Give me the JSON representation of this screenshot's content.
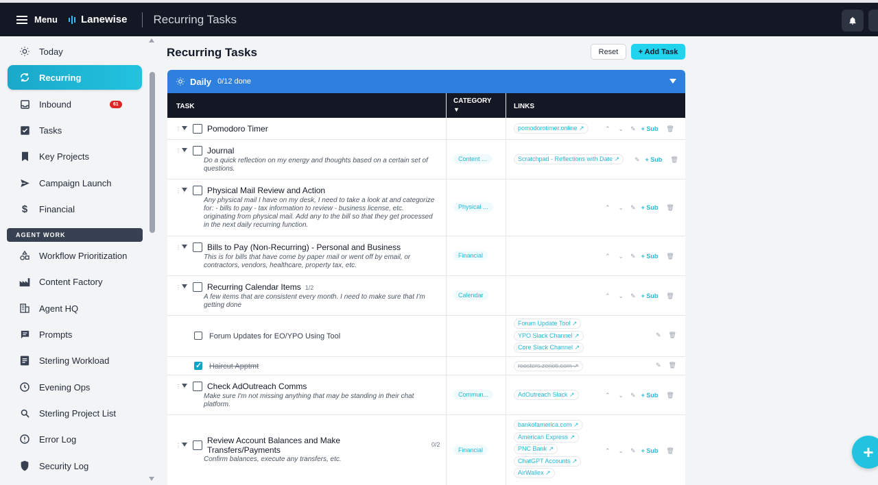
{
  "topbar": {
    "menu_label": "Menu",
    "brand": "Lanewise",
    "page_title": "Recurring Tasks",
    "bell_icon": "bell-icon"
  },
  "sidebar": {
    "items": [
      {
        "label": "Today",
        "icon": "sun-icon"
      },
      {
        "label": "Recurring",
        "icon": "refresh-icon",
        "active": true
      },
      {
        "label": "Inbound",
        "icon": "inbox-icon",
        "badge": "61"
      },
      {
        "label": "Tasks",
        "icon": "checkbox-icon"
      },
      {
        "label": "Key Projects",
        "icon": "bookmark-icon"
      },
      {
        "label": "Campaign Launch",
        "icon": "send-icon"
      },
      {
        "label": "Financial",
        "icon": "dollar-icon"
      }
    ],
    "section_label": "AGENT WORK",
    "agent_items": [
      {
        "label": "Workflow Prioritization",
        "icon": "shapes-icon"
      },
      {
        "label": "Content Factory",
        "icon": "factory-icon"
      },
      {
        "label": "Agent HQ",
        "icon": "building-icon"
      },
      {
        "label": "Prompts",
        "icon": "chat-icon"
      },
      {
        "label": "Sterling Workload",
        "icon": "document-icon"
      },
      {
        "label": "Evening Ops",
        "icon": "clock-icon"
      },
      {
        "label": "Sterling Project List",
        "icon": "search-icon"
      },
      {
        "label": "Error Log",
        "icon": "alert-icon"
      },
      {
        "label": "Security Log",
        "icon": "shield-icon"
      }
    ]
  },
  "main": {
    "title": "Recurring Tasks",
    "reset_label": "Reset",
    "add_label": "+ Add Task",
    "group": {
      "name": "Daily",
      "progress": "0/12 done"
    },
    "columns": {
      "task": "TASK",
      "category": "CATEGORY",
      "category_sort": "▼",
      "links": "LINKS"
    },
    "tasks": [
      {
        "title": "Pomodoro Timer",
        "desc": "",
        "category": "",
        "links": [
          "pomodorotimer.online ↗"
        ]
      },
      {
        "title": "Journal",
        "desc": "Do a quick reflection on my energy and thoughts based on a certain set of questions.",
        "category": "Content ...",
        "links": [
          "Scratchpad - Reflections with Date ↗"
        ]
      },
      {
        "title": "Physical Mail Review and Action",
        "desc": "Any physical mail I have on my desk, I need to take a look at and categorize for: - bills to pay - tax information to review - business license, etc. originating from physical mail. Add any to the bill so that they get processed in the next daily recurring function.",
        "category": "Physical ...",
        "links": []
      },
      {
        "title": "Bills to Pay (Non-Recurring) - Personal and Business",
        "desc": "This is for bills that have come by paper mail or went off by email, or contractors, vendors, healthcare, property tax, etc.",
        "category": "Financial",
        "links": []
      },
      {
        "title": "Recurring Calendar Items",
        "count": "1/2",
        "desc": "A few items that are consistent every month. I need to make sure that I'm getting done",
        "category": "Calendar",
        "links": []
      },
      {
        "title": "Forum Updates for EO/YPO Using Tool",
        "subtask": true,
        "links": [
          "Forum Update Tool ↗",
          "YPO Slack Channel ↗",
          "Core Slack Channel ↗"
        ]
      },
      {
        "title": "Haircut Apptmt",
        "subtask": true,
        "done": true,
        "links": [
          "roosters.zenoti.com ↗"
        ]
      },
      {
        "title": "Check AdOutreach Comms",
        "desc": "Make sure I'm not missing anything that may be standing in their chat platform.",
        "category": "Commun...",
        "links": [
          "AdOutreach Slack ↗"
        ]
      },
      {
        "title": "Review Account Balances and Make Transfers/Payments",
        "count": "0/2",
        "desc": "Confirm balances, execute any transfers, etc.",
        "category": "Financial",
        "links": [
          "bankofamerica.com ↗",
          "American Express ↗",
          "PNC Bank ↗",
          "ChatGPT Accounts ↗",
          "AirWallex ↗"
        ]
      }
    ],
    "action_sub": "+ Sub"
  },
  "colors": {
    "accent": "#22c3e0",
    "group_bar": "#2f7fde",
    "header_dark": "#141824",
    "badge": "#dc2626"
  }
}
